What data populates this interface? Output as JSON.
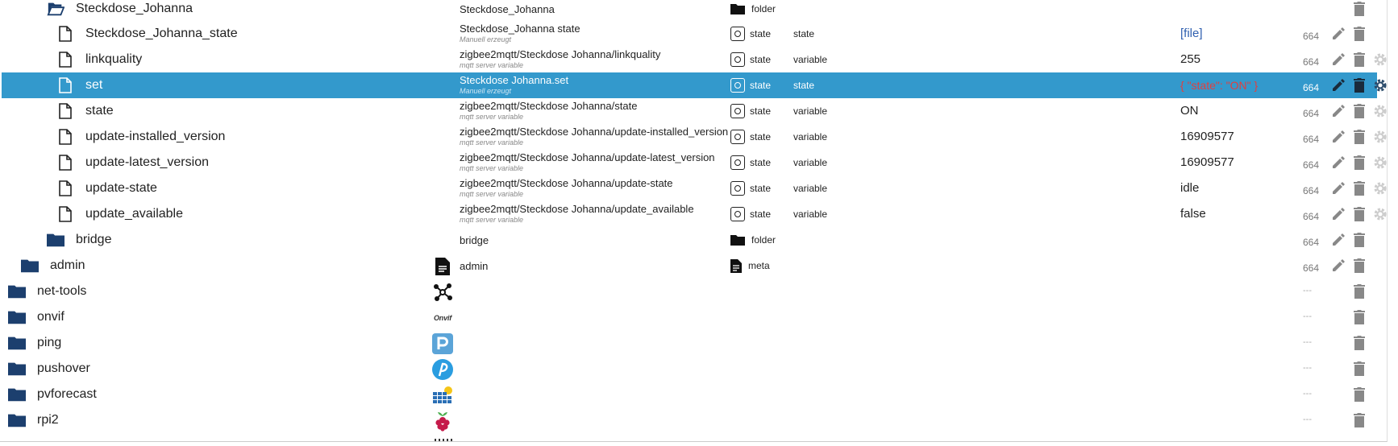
{
  "rows": [
    {
      "name": "Steckdose_Johanna",
      "desc": "Steckdose_Johanna",
      "type": "folder"
    },
    {
      "name": "Steckdose_Johanna_state",
      "desc": "Steckdose_Johanna state",
      "sub": "Manuell erzeugt",
      "type": "state",
      "role": "state",
      "value": "[file]",
      "acl": "664"
    },
    {
      "name": "linkquality",
      "desc": "zigbee2mqtt/Steckdose Johanna/linkquality",
      "sub": "mqtt server variable",
      "type": "state",
      "role": "variable",
      "value": "255",
      "acl": "664"
    },
    {
      "name": "set",
      "desc": "Steckdose Johanna.set",
      "sub": "Manuell erzeugt",
      "type": "state",
      "role": "state",
      "value": "{ \"state\": \"ON\" }",
      "acl": "664"
    },
    {
      "name": "state",
      "desc": "zigbee2mqtt/Steckdose Johanna/state",
      "sub": "mqtt server variable",
      "type": "state",
      "role": "variable",
      "value": "ON",
      "acl": "664"
    },
    {
      "name": "update-installed_version",
      "desc": "zigbee2mqtt/Steckdose Johanna/update-installed_version",
      "sub": "mqtt server variable",
      "type": "state",
      "role": "variable",
      "value": "16909577",
      "acl": "664"
    },
    {
      "name": "update-latest_version",
      "desc": "zigbee2mqtt/Steckdose Johanna/update-latest_version",
      "sub": "mqtt server variable",
      "type": "state",
      "role": "variable",
      "value": "16909577",
      "acl": "664"
    },
    {
      "name": "update-state",
      "desc": "zigbee2mqtt/Steckdose Johanna/update-state",
      "sub": "mqtt server variable",
      "type": "state",
      "role": "variable",
      "value": "idle",
      "acl": "664"
    },
    {
      "name": "update_available",
      "desc": "zigbee2mqtt/Steckdose Johanna/update_available",
      "sub": "mqtt server variable",
      "type": "state",
      "role": "variable",
      "value": "false",
      "acl": "664"
    },
    {
      "name": "bridge",
      "desc": "bridge",
      "type": "folder",
      "acl": "664"
    },
    {
      "name": "admin",
      "desc": "admin",
      "type": "meta",
      "acl": "664"
    },
    {
      "name": "net-tools",
      "acl": "---"
    },
    {
      "name": "onvif",
      "acl": "---",
      "adapter_label": "Onvif"
    },
    {
      "name": "ping",
      "acl": "---"
    },
    {
      "name": "pushover",
      "acl": "---"
    },
    {
      "name": "pvforecast",
      "acl": "---"
    },
    {
      "name": "rpi2",
      "acl": "---"
    }
  ],
  "icons": {
    "folder_open": "folder-open-icon",
    "folder": "folder-icon",
    "file": "file-icon",
    "meta": "meta-doc-icon",
    "state": "state-icon",
    "edit": "pencil-icon",
    "delete": "trash-icon",
    "settings": "gear-icon"
  },
  "colors": {
    "selection": "#3399cc",
    "folder": "#1c3f6e",
    "value_link": "#3060b0",
    "value_red": "#e04040"
  }
}
